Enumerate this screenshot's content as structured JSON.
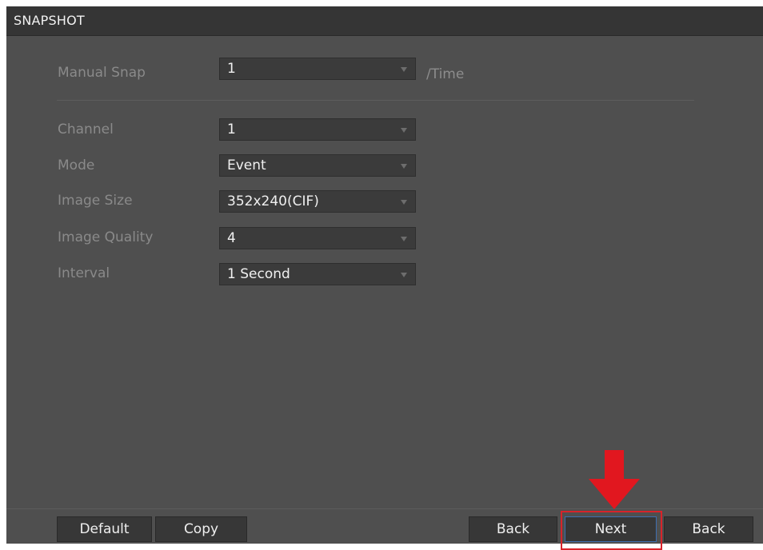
{
  "window": {
    "title": "SNAPSHOT"
  },
  "manual_snap": {
    "label": "Manual Snap",
    "value": "1",
    "suffix": "/Time"
  },
  "settings": {
    "channel": {
      "label": "Channel",
      "value": "1"
    },
    "mode": {
      "label": "Mode",
      "value": "Event"
    },
    "image_size": {
      "label": "Image Size",
      "value": "352x240(CIF)"
    },
    "image_quality": {
      "label": "Image Quality",
      "value": "4"
    },
    "interval": {
      "label": "Interval",
      "value": "1 Second"
    }
  },
  "buttons": {
    "default": "Default",
    "copy": "Copy",
    "back": "Back",
    "next": "Next",
    "back2": "Back"
  },
  "annotation": {
    "arrow_color": "#e1171f",
    "highlight_color": "#d8232a",
    "arrow_icon": "arrow-down-icon"
  }
}
